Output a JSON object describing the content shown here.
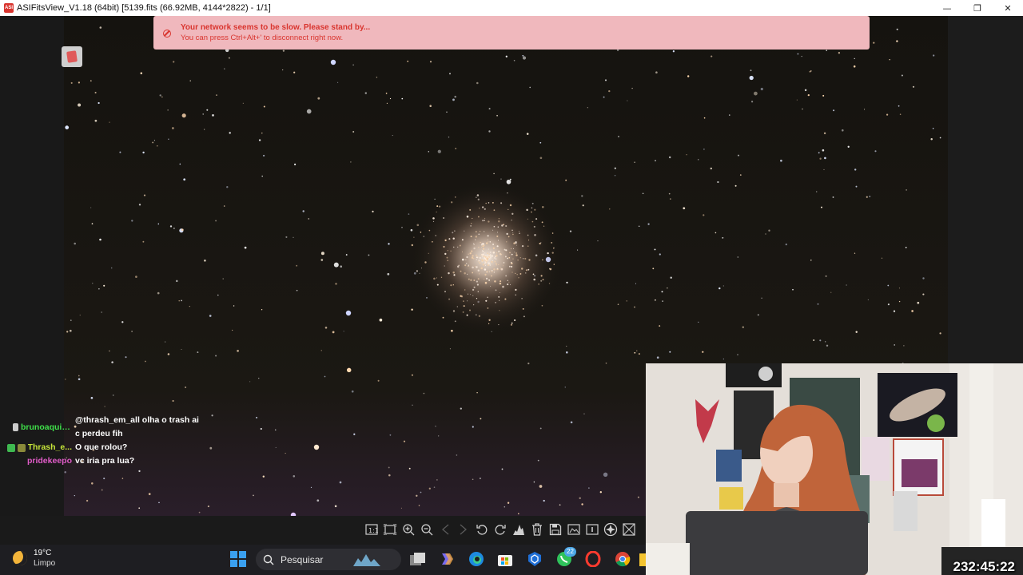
{
  "window": {
    "title": "ASIFitsView_V1.18 (64bit) [5139.fits (66.92MB, 4144*2822) - 1/1]",
    "app_icon_text": "ASI",
    "accent_color": "#d9352f",
    "controls": {
      "minimize": "—",
      "maximize": "❐",
      "close": "✕"
    }
  },
  "banner": {
    "title": "Your network seems to be slow. Please stand by...",
    "subtitle": "You can press Ctrl+Alt+' to disconnect right now.",
    "bg_color": "#f0b8bd",
    "text_color": "#d9352f"
  },
  "toolbar": {
    "icons": [
      "fit-icon",
      "actual-size-icon",
      "zoom-in-icon",
      "zoom-out-icon",
      "previous-icon",
      "next-icon",
      "rotate-left-icon",
      "rotate-right-icon",
      "histogram-icon",
      "delete-icon",
      "save-icon",
      "image-icon",
      "info-icon",
      "annotate-icon",
      "crosshair-icon"
    ]
  },
  "chat": {
    "messages": [
      {
        "user": "brunoaquite...",
        "user_color": "#3fe04a",
        "text": "@thrash_em_all olha o trash ai c perdeu fih",
        "badges": [
          "#cccccc"
        ]
      },
      {
        "user": "Thrash_e...",
        "user_color": "#c7e63a",
        "text": "O que rolou?",
        "badges": [
          "#3fb950",
          "#8a8a3a"
        ]
      },
      {
        "user": "pridekeepo",
        "user_color": "#e05cc8",
        "text": "vc iria pra lua?",
        "badges": []
      }
    ]
  },
  "stream": {
    "timer": "232:45:22"
  },
  "taskbar": {
    "weather": {
      "temperature": "19°C",
      "condition": "Limpo"
    },
    "search_placeholder": "Pesquisar",
    "notification_count": "22",
    "apps": [
      "windows-start-icon",
      "search-icon",
      "task-view-icon",
      "copilot-icon",
      "edge-icon",
      "store-icon",
      "defender-icon",
      "whatsapp-icon",
      "opera-icon",
      "chrome-icon"
    ]
  }
}
